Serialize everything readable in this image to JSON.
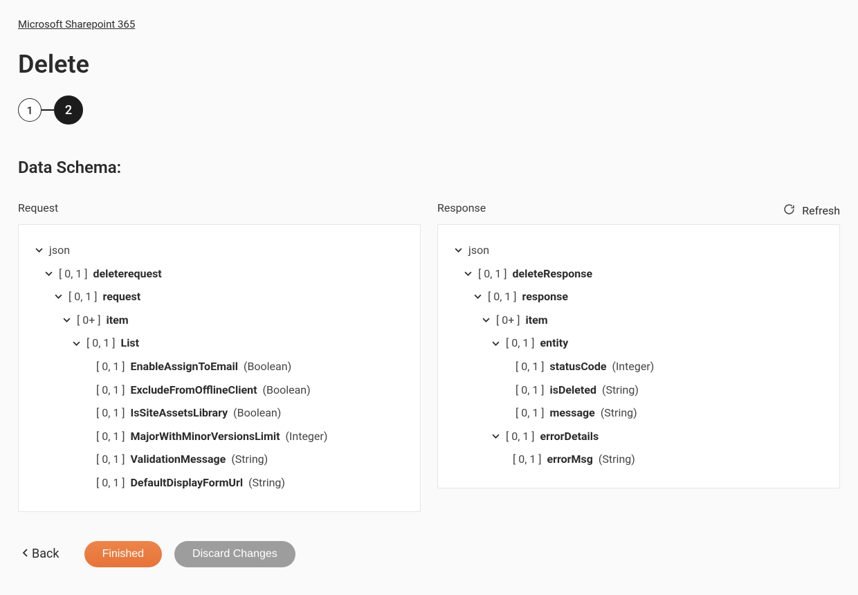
{
  "breadcrumb": "Microsoft Sharepoint 365",
  "title": "Delete",
  "stepper": {
    "step1": "1",
    "step2": "2"
  },
  "sectionTitle": "Data Schema:",
  "refreshLabel": "Refresh",
  "requestLabel": "Request",
  "responseLabel": "Response",
  "backLabel": "Back",
  "finishedLabel": "Finished",
  "discardLabel": "Discard Changes",
  "request": {
    "root": {
      "name": "json"
    },
    "n1": {
      "card": "[ 0, 1 ] ",
      "name": "deleterequest"
    },
    "n2": {
      "card": "[ 0, 1 ] ",
      "name": "request"
    },
    "n3": {
      "card": "[ 0+ ] ",
      "name": "item"
    },
    "n4": {
      "card": "[ 0, 1 ] ",
      "name": "List"
    },
    "n5": {
      "card": "[ 0, 1 ] ",
      "name": "EnableAssignToEmail",
      "type": " (Boolean)"
    },
    "n6": {
      "card": "[ 0, 1 ] ",
      "name": "ExcludeFromOfflineClient",
      "type": " (Boolean)"
    },
    "n7": {
      "card": "[ 0, 1 ] ",
      "name": "IsSiteAssetsLibrary",
      "type": " (Boolean)"
    },
    "n8": {
      "card": "[ 0, 1 ] ",
      "name": "MajorWithMinorVersionsLimit",
      "type": " (Integer)"
    },
    "n9": {
      "card": "[ 0, 1 ] ",
      "name": "ValidationMessage",
      "type": " (String)"
    },
    "n10": {
      "card": "[ 0, 1 ] ",
      "name": "DefaultDisplayFormUrl",
      "type": " (String)"
    }
  },
  "response": {
    "root": {
      "name": "json"
    },
    "n1": {
      "card": "[ 0, 1 ] ",
      "name": "deleteResponse"
    },
    "n2": {
      "card": "[ 0, 1 ] ",
      "name": "response"
    },
    "n3": {
      "card": "[ 0+ ] ",
      "name": "item"
    },
    "n4": {
      "card": "[ 0, 1 ] ",
      "name": "entity"
    },
    "n5": {
      "card": "[ 0, 1 ] ",
      "name": "statusCode",
      "type": " (Integer)"
    },
    "n6": {
      "card": "[ 0, 1 ] ",
      "name": "isDeleted",
      "type": " (String)"
    },
    "n7": {
      "card": "[ 0, 1 ] ",
      "name": "message",
      "type": " (String)"
    },
    "n8": {
      "card": "[ 0, 1 ] ",
      "name": "errorDetails"
    },
    "n9": {
      "card": "[ 0, 1 ] ",
      "name": "errorMsg",
      "type": " (String)"
    }
  }
}
